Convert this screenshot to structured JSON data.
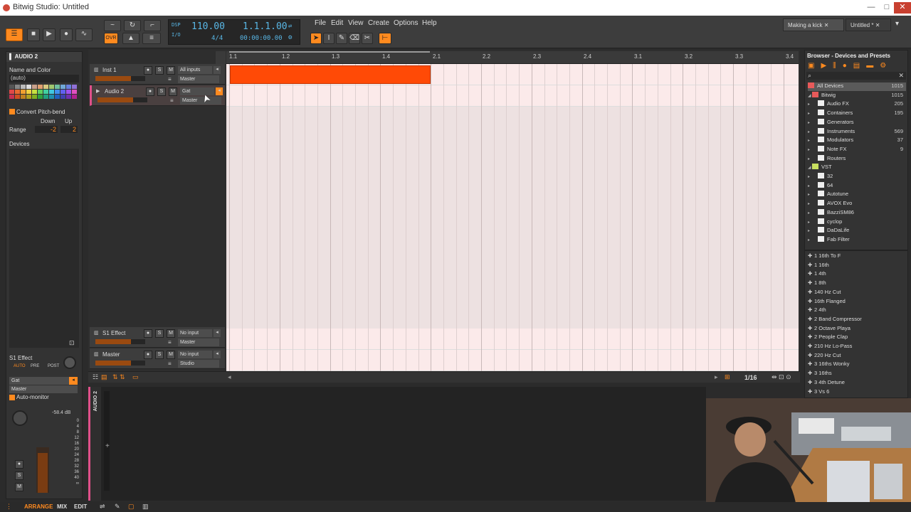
{
  "window": {
    "title": "Bitwig Studio: Untitled",
    "min": "—",
    "max": "□",
    "close": "✕"
  },
  "transport": {
    "bpm": "110.00",
    "signature": "4/4",
    "position": "1.1.1.00",
    "time": "00:00:00.00",
    "dsp": "DSP",
    "io": "I/O",
    "ovr": "OVR"
  },
  "menu": [
    "File",
    "Edit",
    "View",
    "Create",
    "Options",
    "Help"
  ],
  "tabs": [
    {
      "label": "Making a kick"
    },
    {
      "label": "Untitled *"
    }
  ],
  "inspector": {
    "track_title": "AUDIO 2",
    "name_color_label": "Name and Color",
    "name_value": "(auto)",
    "convert_label": "Convert Pitch-bend",
    "down_label": "Down",
    "up_label": "Up",
    "range_label": "Range",
    "range_down": "-2",
    "range_up": "2",
    "devices_label": "Devices",
    "send_title": "S1 Effect",
    "auto": "AUTO",
    "pre": "PRE",
    "post": "POST",
    "input_value": "Gat",
    "output_value": "Master",
    "auto_monitor": "Auto-monitor",
    "db_value": "-58.4 dB",
    "meter_scale": [
      "0",
      "4",
      "8",
      "12",
      "16",
      "20",
      "24",
      "28",
      "32",
      "36",
      "40",
      "∞"
    ],
    "s_label": "S",
    "m_label": "M"
  },
  "tracks": [
    {
      "name": "Inst 1",
      "input": "All inputs",
      "output": "Master",
      "s": "S",
      "m": "M"
    },
    {
      "name": "Audio 2",
      "input": "Gat",
      "output": "Master",
      "s": "S",
      "m": "M"
    },
    {
      "name": "S1 Effect",
      "input": "No input",
      "output": "Master",
      "s": "S",
      "m": "M"
    },
    {
      "name": "Master",
      "input": "No input",
      "output": "Studio",
      "s": "S",
      "m": "M"
    }
  ],
  "ruler": [
    "1.1",
    "1.2",
    "1.3",
    "1.4",
    "2.1",
    "2.2",
    "2.3",
    "2.4",
    "3.1",
    "3.2",
    "3.3",
    "3.4"
  ],
  "zoom_label": "1/16",
  "browser": {
    "title": "Browser - Devices and Presets",
    "tree": [
      {
        "label": "All Devices",
        "count": "1015"
      },
      {
        "label": "Bitwig",
        "count": "1015"
      },
      {
        "label": "Audio FX",
        "count": "205"
      },
      {
        "label": "Containers",
        "count": "195"
      },
      {
        "label": "Generators",
        "count": ""
      },
      {
        "label": "Instruments",
        "count": "569"
      },
      {
        "label": "Modulators",
        "count": "37"
      },
      {
        "label": "Note FX",
        "count": "9"
      },
      {
        "label": "Routers",
        "count": ""
      },
      {
        "label": "VST",
        "count": ""
      },
      {
        "label": "32",
        "count": ""
      },
      {
        "label": "64",
        "count": ""
      },
      {
        "label": "Autotune",
        "count": ""
      },
      {
        "label": "AVOX Evo",
        "count": ""
      },
      {
        "label": "BazziSM86",
        "count": ""
      },
      {
        "label": "cyclop",
        "count": ""
      },
      {
        "label": "DaDaLife",
        "count": ""
      },
      {
        "label": "Fab Filter",
        "count": ""
      }
    ],
    "presets": [
      "1 16th To F",
      "1 16th",
      "1 4th",
      "1 8th",
      "140 Hz Cut",
      "16th Flanged",
      "2 4th",
      "2 Band Compressor",
      "2 Octave Playa",
      "2 People Clap",
      "210 Hz Lo-Pass",
      "220 Hz Cut",
      "3 16ths Wonky",
      "3 16ths",
      "3 4th Detune",
      "3 Vs 6"
    ]
  },
  "detail": {
    "label": "AUDIO 2"
  },
  "bottom": {
    "arrange": "ARRANGE",
    "mix": "MIX",
    "edit": "EDIT"
  },
  "colors": {
    "accent": "#ff8a1f",
    "clip": "#ff4a06",
    "lcd": "#59b7e6",
    "track_pink": "#e0508a"
  }
}
